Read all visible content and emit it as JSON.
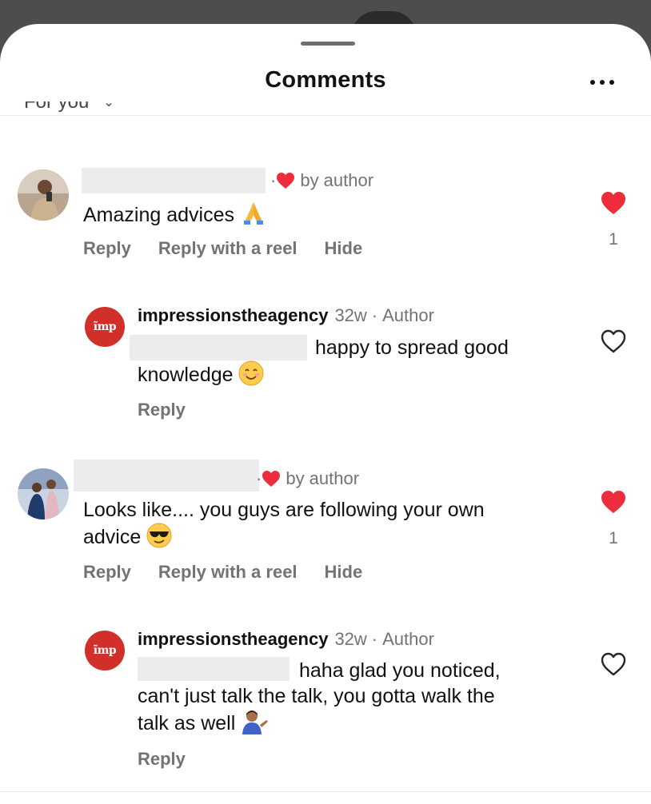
{
  "header": {
    "title": "Comments"
  },
  "sort": {
    "label": "For you"
  },
  "comments": [
    {
      "by_author_label": "by author",
      "text": "Amazing advices",
      "emoji": "folded-hands",
      "actions": [
        "Reply",
        "Reply with a reel",
        "Hide"
      ],
      "liked": true,
      "like_count": "1",
      "reply": {
        "username": "impressionstheagency",
        "time": "32w",
        "badge": "Author",
        "avatar_text": "ĩmp",
        "text_line1": "happy to spread good",
        "text_line2": "knowledge",
        "emoji": "smiling-face",
        "action": "Reply",
        "liked": false
      }
    },
    {
      "by_author_label": "by author",
      "text_line1": "Looks like.... you guys are following your own",
      "text_line2": "advice",
      "emoji": "sunglasses-face",
      "actions": [
        "Reply",
        "Reply with a reel",
        "Hide"
      ],
      "liked": true,
      "like_count": "1",
      "reply": {
        "username": "impressionstheagency",
        "time": "32w",
        "badge": "Author",
        "avatar_text": "ĩmp",
        "text_line1": "haha glad you noticed,",
        "text_line2": "can't just talk the talk, you gotta walk the",
        "text_line3": "talk as well",
        "emoji": "person-tipping-hand",
        "action": "Reply",
        "liked": false
      }
    }
  ],
  "colors": {
    "heart": "#ed2d3c",
    "brand": "#d12f2a",
    "muted": "#737373"
  }
}
